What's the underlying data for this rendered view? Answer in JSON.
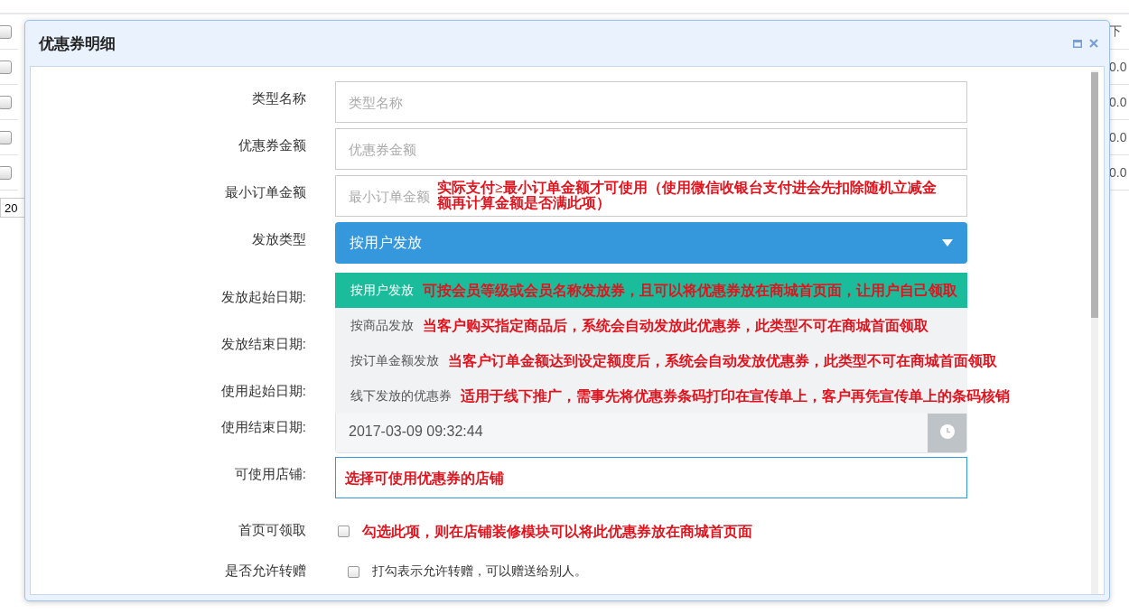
{
  "background": {
    "row_checkboxes": [
      {
        "checked": false
      },
      {
        "checked": false
      },
      {
        "checked": false
      },
      {
        "checked": false
      },
      {
        "checked": false
      }
    ],
    "pager_size": "20",
    "column_header": "下",
    "cells": [
      "0.0",
      "0.0",
      "0.0",
      "0.0"
    ]
  },
  "dialog": {
    "title": "优惠券明细",
    "fields": [
      {
        "kind": "input",
        "label": "类型名称",
        "placeholder": "类型名称"
      },
      {
        "kind": "input",
        "label": "优惠券金额",
        "placeholder": "优惠券金额"
      },
      {
        "kind": "input",
        "label": "最小订单金额",
        "placeholder": "最小订单金额",
        "note": "实际支付≥最小订单金额才可使用（使用微信收银台支付进会先扣除随机立减金额再计算金额是否满此项）"
      },
      {
        "kind": "select",
        "label": "发放类型",
        "value": "按用户发放",
        "expanded": true,
        "options": [
          {
            "label": "按用户发放",
            "selected": true,
            "note": "可按会员等级或会员名称发放券，且可以将优惠券放在商城首页面，让用户自己领取"
          },
          {
            "label": "按商品发放",
            "selected": false,
            "note": "当客户购买指定商品后，系统会自动发放此优惠券，此类型不可在商城首面领取"
          },
          {
            "label": "按订单金额发放",
            "selected": false,
            "note": "当客户订单金额达到设定额度后，系统会自动发放优惠券，此类型不可在商城首面领取"
          },
          {
            "label": "线下发放的优惠券",
            "selected": false,
            "note": "适用于线下推广，需事先将优惠券条码打印在宣传单上，客户再凭宣传单上的条码核销"
          }
        ]
      },
      {
        "kind": "covered",
        "label": "发放起始日期:"
      },
      {
        "kind": "covered",
        "label": "发放结束日期:"
      },
      {
        "kind": "covered",
        "label": "使用起始日期:"
      },
      {
        "kind": "date",
        "label": "使用结束日期:",
        "value": "2017-03-09 09:32:44"
      },
      {
        "kind": "store",
        "label": "可使用店铺:",
        "note": "选择可使用优惠券的店铺"
      },
      {
        "kind": "checkbox",
        "label": "首页可领取",
        "checked": false,
        "note": "勾选此项，则在店铺装修模块可以将此优惠券放在商城首页面"
      },
      {
        "kind": "checkbox",
        "label": "是否允许转赠",
        "checked": false,
        "text": "打勾表示允许转赠，可以赠送给别人。"
      }
    ]
  }
}
